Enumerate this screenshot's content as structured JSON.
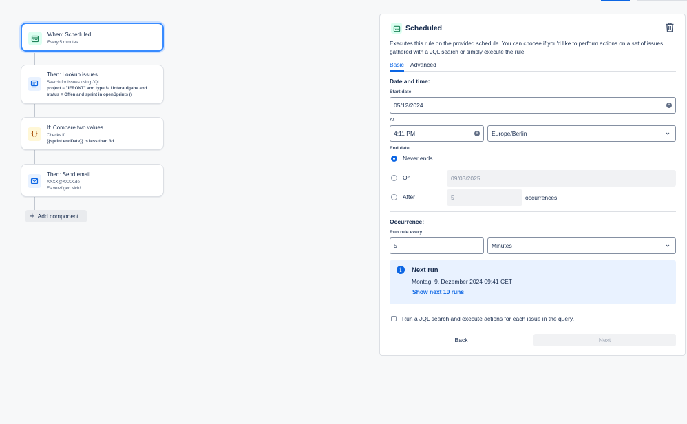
{
  "flow": {
    "trigger": {
      "title": "When: Scheduled",
      "subtitle": "Every 5 minutes"
    },
    "lookup": {
      "title": "Then: Lookup issues",
      "subtitle": "Search for issues using JQL",
      "query_line1": "project = \"IFRONT\" and type != Unteraufgabe and",
      "query_line2": "status = Offen and sprint in openSprints ()"
    },
    "compare": {
      "title": "If: Compare two values",
      "subtitle": "Checks if:",
      "condition": "{{sprint.endDate}} is less than 3d"
    },
    "email": {
      "title": "Then: Send email",
      "to": "XXXX@XXXX.de",
      "body": "Es verzögert sich!"
    },
    "add_component_label": "Add component"
  },
  "panel": {
    "title": "Scheduled",
    "description": "Executes this rule on the provided schedule. You can choose if you'd like to perform actions on a set of issues gathered with a JQL search or simply execute the rule.",
    "tabs": [
      {
        "label": "Basic",
        "active": true
      },
      {
        "label": "Advanced",
        "active": false
      }
    ],
    "date_time_heading": "Date and time:",
    "start_date_label": "Start date",
    "start_date_value": "05/12/2024",
    "at_label": "At",
    "at_value": "4:11 PM",
    "timezone_value": "Europe/Berlin",
    "end_date_label": "End date",
    "never_ends_label": "Never ends",
    "on_label": "On",
    "on_date_value": "09/03/2025",
    "after_label": "After",
    "after_value": "5",
    "occurrences_label": "occurrences",
    "occurrence_heading": "Occurrence:",
    "run_rule_every_label": "Run rule every",
    "run_rule_every_value": "5",
    "interval_unit_value": "Minutes",
    "next_run": {
      "title": "Next run",
      "date": "Montag, 9. Dezember 2024 09:41 CET",
      "link": "Show next 10 runs"
    },
    "jql_checkbox_label": "Run a JQL search and execute actions for each issue in the query.",
    "back_label": "Back",
    "next_label": "Next"
  },
  "colors": {
    "accent": "#0c66e4",
    "selected_border": "#388bff",
    "info_bg": "#e9f2ff"
  }
}
